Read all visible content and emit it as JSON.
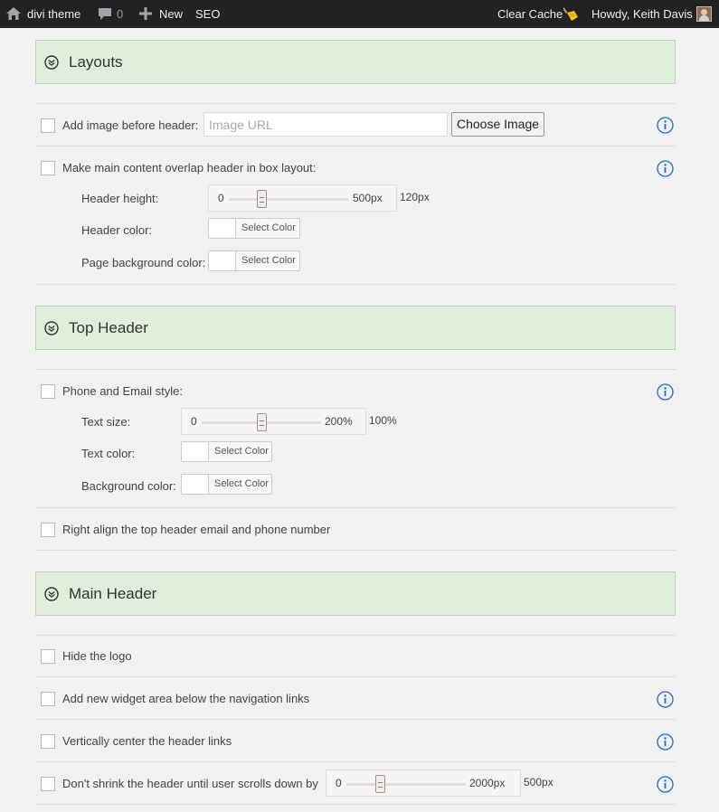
{
  "adminbar": {
    "site_name": "divi theme",
    "comments_count": "0",
    "new_label": "New",
    "seo_label": "SEO",
    "clear_cache_label": "Clear Cache",
    "howdy_label": "Howdy, Keith Davis",
    "icons": [
      "home-icon",
      "comment-icon",
      "plus-icon",
      "broom-icon",
      "avatar"
    ]
  },
  "colors": {
    "adminbar_bg": "#222222",
    "section_bg": "#dfefdc",
    "page_bg": "#f1f1f1",
    "info_icon": "#1e6ec8"
  },
  "layouts": {
    "title": "Layouts",
    "add_image": {
      "label": "Add image before header:",
      "url_placeholder": "Image URL",
      "url_value": "",
      "button_label": "Choose Image",
      "checked": false
    },
    "overlap": {
      "label": "Make main content overlap header in box layout:",
      "checked": false,
      "header_height": {
        "label": "Header height:",
        "min": "0",
        "max": "500px",
        "value": "120px",
        "fraction": 0.24
      },
      "header_color": {
        "label": "Header color:",
        "button": "Select Color"
      },
      "page_bg_color": {
        "label": "Page background color:",
        "button": "Select Color"
      }
    }
  },
  "top_header": {
    "title": "Top Header",
    "phone_email": {
      "label": "Phone and Email style:",
      "checked": false,
      "text_size": {
        "label": "Text size:",
        "min": "0",
        "max": "200%",
        "value": "100%",
        "fraction": 0.5
      },
      "text_color": {
        "label": "Text color:",
        "button": "Select Color"
      },
      "bg_color": {
        "label": "Background color:",
        "button": "Select Color"
      }
    },
    "right_align": {
      "label": "Right align the top header email and phone number",
      "checked": false
    }
  },
  "main_header": {
    "title": "Main Header",
    "hide_logo": {
      "label": "Hide the logo",
      "checked": false
    },
    "widget_area": {
      "label": "Add new widget area below the navigation links",
      "checked": false
    },
    "vcenter": {
      "label": "Vertically center the header links",
      "checked": false
    },
    "shrink": {
      "label": "Don't shrink the header until user scrolls down by",
      "checked": false,
      "min": "0",
      "max": "2000px",
      "value": "500px",
      "fraction": 0.25
    }
  }
}
